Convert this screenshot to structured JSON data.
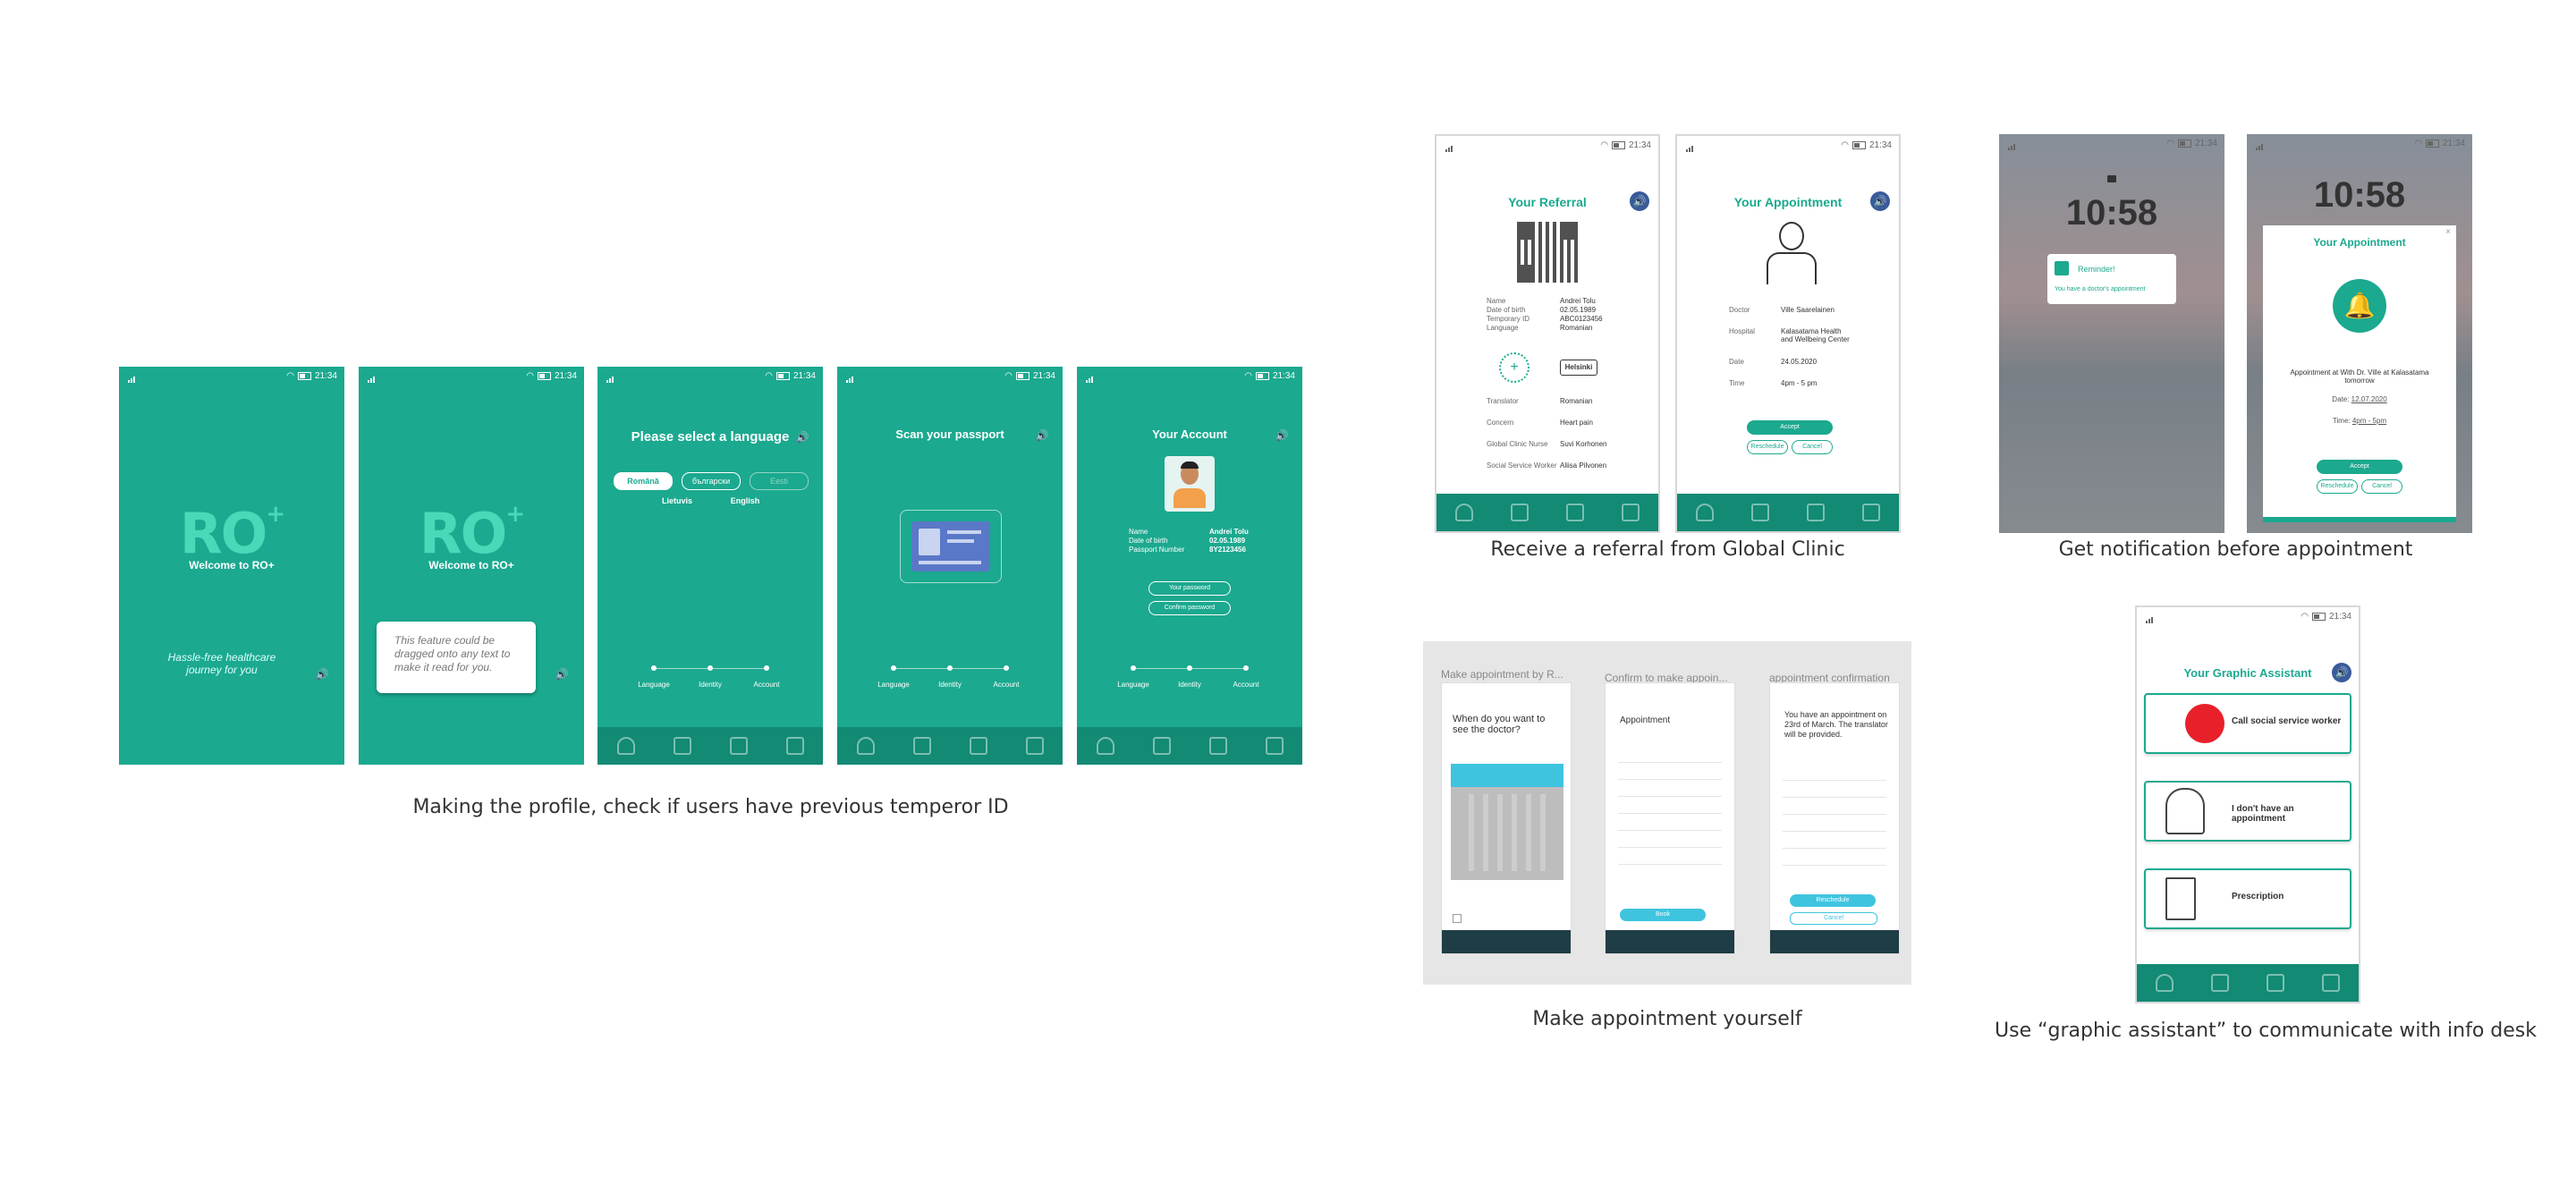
{
  "status": {
    "time": "21:34"
  },
  "captions": {
    "profile": "Making the profile, check if users have previous temperor ID",
    "referral": "Receive a referral from Global Clinic",
    "notification": "Get notification before appointment",
    "self_appointment": "Make appointment yourself",
    "assistant": "Use “graphic assistant” to communicate with info desk"
  },
  "welcome": {
    "logo": "RO",
    "logo_sup": "+",
    "subtitle": "Welcome to RO+",
    "tagline": "Hassle-free healthcare journey for you"
  },
  "tooltip": "This feature could be dragged onto any text to make it read for you.",
  "language": {
    "title": "Please select a language",
    "options": [
      "Română",
      "български",
      "Eesti",
      "Lietuvis",
      "English"
    ]
  },
  "steps": [
    "Language",
    "Identity",
    "Account"
  ],
  "passport": {
    "title": "Scan your passport"
  },
  "account": {
    "title": "Your Account",
    "fields": [
      {
        "k": "Name",
        "v": "Andrei Tolu"
      },
      {
        "k": "Date of birth",
        "v": "02.05.1989"
      },
      {
        "k": "Passport Number",
        "v": "8Y2123456"
      }
    ],
    "password": "Your password",
    "confirm": "Confirm password"
  },
  "referral": {
    "title": "Your Referral",
    "fields": [
      {
        "k": "Name",
        "v": "Andrei Tolu"
      },
      {
        "k": "Date of birth",
        "v": "02.05.1989"
      },
      {
        "k": "Temporary ID",
        "v": "ABC0123456"
      },
      {
        "k": "Language",
        "v": "Romanian"
      }
    ],
    "city": "Helsinki",
    "fields2": [
      {
        "k": "Translator",
        "v": "Romanian"
      },
      {
        "k": "Concern",
        "v": "Heart pain"
      },
      {
        "k": "Global Clinic Nurse",
        "v": "Suvi Korhonen"
      },
      {
        "k": "Social Service Worker",
        "v": "Aliisa Pilvonen"
      }
    ]
  },
  "appointment": {
    "title": "Your Appointment",
    "fields": [
      {
        "k": "Doctor",
        "v": "Ville Saarelainen"
      },
      {
        "k": "Hospital",
        "v": "Kalasatama Health and Wellbeing Center"
      },
      {
        "k": "Date",
        "v": "24.05.2020"
      },
      {
        "k": "Time",
        "v": "4pm - 5 pm"
      }
    ],
    "accept": "Accept",
    "reschedule": "Reschedule",
    "cancel": "Cancel"
  },
  "lock": {
    "clock": "10:58",
    "reminder_title": "Reminder!",
    "reminder_text": "You have a doctor's appointment",
    "modal_title": "Your Appointment",
    "modal_text": "Appointment at With Dr. Ville at Kalasatama tomorrow",
    "date_label": "Date:",
    "date": "12.07.2020",
    "time_label": "Time:",
    "time": "4pm - 5pm",
    "accept": "Accept",
    "reschedule": "Reschedule",
    "cancel": "Cancel"
  },
  "self": {
    "screens": [
      {
        "label": "Make appointment by R...",
        "question": "When do you want to see the doctor?"
      },
      {
        "label": "Confirm to make appoin...",
        "question": "Appointment",
        "book": "Book"
      },
      {
        "label": "appointment confirmation",
        "question": "You have an appointment on 23rd of March. The translator will be provided.",
        "reschedule": "Reschedule",
        "cancel": "Cancel"
      }
    ]
  },
  "assistant": {
    "title": "Your Graphic Assistant",
    "items": [
      "Call social service worker",
      "I don't have an appointment",
      "Prescription"
    ]
  },
  "colors": {
    "teal": "#1ba98f",
    "teal_dark": "#128a74",
    "logo": "#4ad8b9",
    "speaker": "#3a5a9a"
  }
}
